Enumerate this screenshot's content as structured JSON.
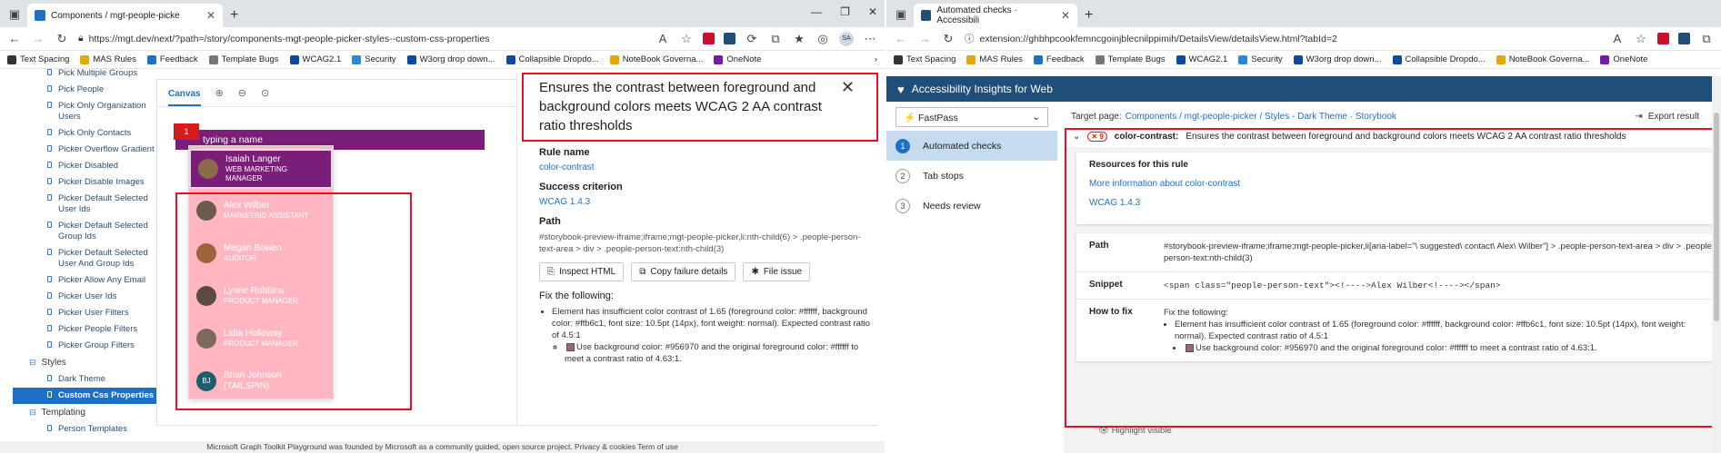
{
  "w1": {
    "tab": {
      "title": "Components / mgt-people-picke",
      "close": "✕"
    },
    "url": "https://mgt.dev/next/?path=/story/components-mgt-people-picker-styles--custom-css-properties",
    "profile": "SA",
    "favorites": [
      "Text Spacing",
      "MAS Rules",
      "Feedback",
      "Template Bugs",
      "WCAG2.1",
      "Security",
      "W3org drop down...",
      "Collapsible Dropdo...",
      "NoteBook Governa...",
      "OneNote"
    ],
    "sidebar": {
      "items": [
        "Pick Multiple Groups",
        "Pick People",
        "Pick Only Organization Users",
        "Pick Only Contacts",
        "Picker Overflow Gradient",
        "Picker Disabled",
        "Picker Disable Images",
        "Picker Default Selected User Ids",
        "Picker Default Selected Group Ids",
        "Picker Default Selected User And Group Ids",
        "Picker Allow Any Email",
        "Picker User Ids",
        "Picker User Filters",
        "Picker People Filters",
        "Picker Group Filters"
      ],
      "group_styles": "Styles",
      "style_items": [
        "Dark Theme",
        "Custom Css Properties"
      ],
      "group_templating": "Templating",
      "templating_items": [
        "Person Templates"
      ]
    },
    "canvas": {
      "tab": "Canvas",
      "placeholder": "typing a name",
      "badge": "1",
      "people": [
        {
          "name": "Isaiah Langer",
          "role": "WEB MARKETING MANAGER"
        },
        {
          "name": "Alex Wilber",
          "role": "MARKETING ASSISTANT"
        },
        {
          "name": "Megan Bowen",
          "role": "AUDITOR"
        },
        {
          "name": "Lynne Robbins",
          "role": "PRODUCT MANAGER"
        },
        {
          "name": "Lidia Holloway",
          "role": "PRODUCT MANAGER"
        },
        {
          "name": "Brian Johnson (TAILSPIN)",
          "role": "",
          "initials": "BJ"
        }
      ]
    },
    "detail": {
      "title": "Ensures the contrast between foreground and background colors meets WCAG 2 AA contrast ratio thresholds",
      "rule_label": "Rule name",
      "rule": "color-contrast",
      "criterion_label": "Success criterion",
      "criterion": "WCAG 1.4.3",
      "path_label": "Path",
      "path": "#storybook-preview-iframe;iframe;mgt-people-picker,li:nth-child(6) > .people-person-text-area > div > .people-person-text:nth-child(3)",
      "btn_inspect": "Inspect HTML",
      "btn_copy": "Copy failure details",
      "btn_issue": "File issue",
      "fix_label": "Fix the following:",
      "fix1": "Element has insufficient color contrast of 1.65 (foreground color: #ffffff, background color: #ffb6c1, font size: 10.5pt (14px), font weight: normal). Expected contrast ratio of 4.5:1",
      "fix2": "Use background color: #956970 and the original foreground color: #ffffff to meet a contrast ratio of 4.63:1."
    },
    "footer": "Microsoft Graph Toolkit Playground was founded by Microsoft as a community guided, open source project. Privacy & cookies Term of use"
  },
  "w2": {
    "tab": {
      "title": "Automated checks · Accessibili",
      "close": "✕"
    },
    "url": "extension://ghbhpcookfemncgoinjblecnilppimih/DetailsView/detailsView.html?tabId=2",
    "header": "Accessibility Insights for Web",
    "fastpass": "FastPass",
    "steps": [
      {
        "num": "1",
        "label": "Automated checks"
      },
      {
        "num": "2",
        "label": "Tab stops"
      },
      {
        "num": "3",
        "label": "Needs review"
      }
    ],
    "target_label": "Target page:",
    "target_link": "Components / mgt-people-picker / Styles - Dark Theme · Storybook",
    "export": "Export result",
    "rule_count": "9",
    "rule_id": "color-contrast:",
    "rule_desc": "Ensures the contrast between foreground and background colors meets WCAG 2 AA contrast ratio thresholds",
    "resources_label": "Resources for this rule",
    "resource_link": "More information about color-contrast",
    "wcag_link": "WCAG 1.4.3",
    "path_label": "Path",
    "path": "#storybook-preview-iframe;iframe;mgt-people-picker,li[aria-label=\"\\ suggested\\ contact\\ Alex\\ Wilber\"] > .people-person-text-area > div > .people-person-text:nth-child(3)",
    "snippet_label": "Snippet",
    "snippet": "<span class=\"people-person-text\"><!---->Alex Wilber<!----></span>",
    "howto_label": "How to fix",
    "fix_label": "Fix the following:",
    "fix1": "Element has insufficient color contrast of 1.65 (foreground color: #ffffff, background color: #ffb6c1, font size: 10.5pt (14px), font weight: normal). Expected contrast ratio of 4.5:1",
    "fix2": "Use background color: #956970 and the original foreground color: #ffffff to meet a contrast ratio of 4.63:1.",
    "highlight": "Highlight visible"
  },
  "colors": {
    "accent": "#1d70c6",
    "picker": "#7b1e7a",
    "pink": "#ffb6c1",
    "error": "#e81123",
    "ai_header": "#1f4e79"
  }
}
